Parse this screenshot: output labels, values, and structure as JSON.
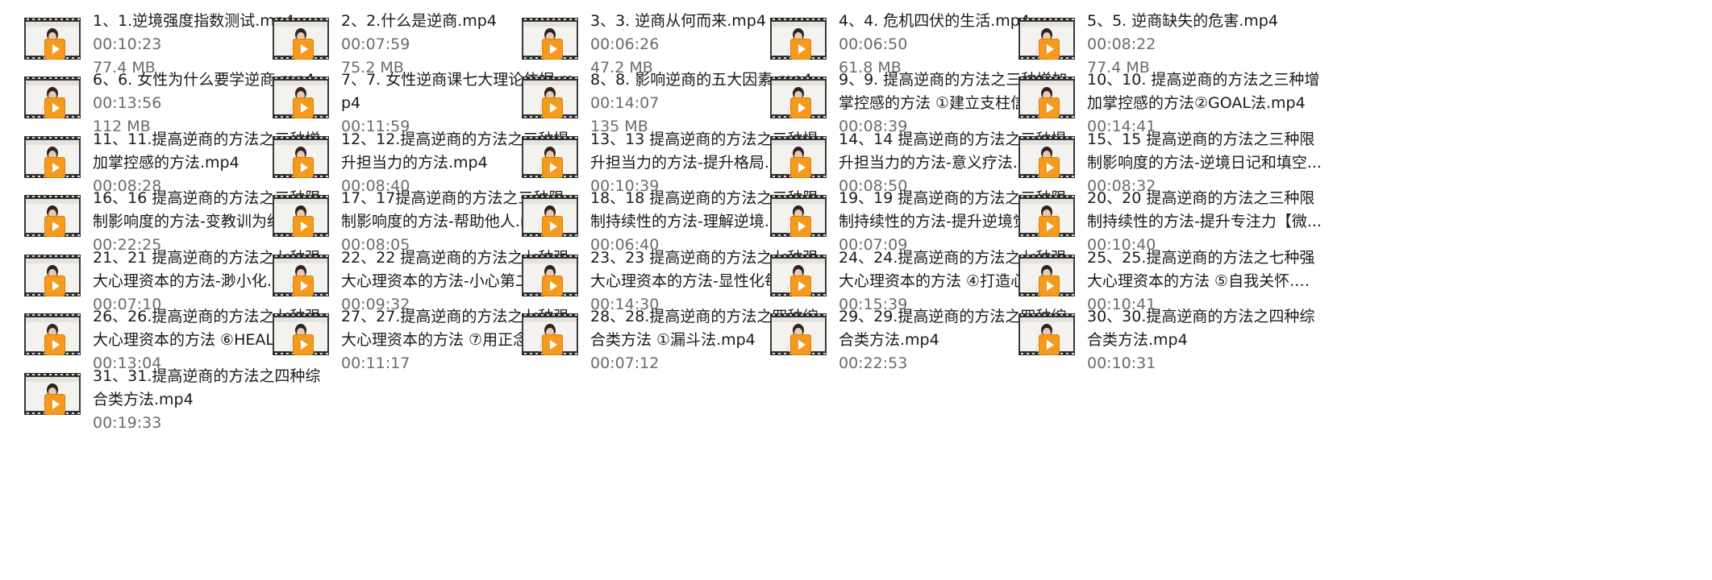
{
  "colors": {
    "background": "#ffffff",
    "filename_text": "#1a1a1a",
    "meta_text": "#6b6b6b",
    "play_badge": "#f49a1e"
  },
  "icons": {
    "thumbnail": "video-thumbnail-icon",
    "play_badge": "play-icon"
  },
  "files": [
    {
      "name": "1、1.逆境强度指数测试.mp4",
      "duration": "00:10:23",
      "size": "77.4 MB"
    },
    {
      "name": "2、2.什么是逆商.mp4",
      "duration": "00:07:59",
      "size": "75.2 MB"
    },
    {
      "name": "3、3. 逆商从何而来.mp4",
      "duration": "00:06:26",
      "size": "47.2 MB"
    },
    {
      "name": "4、4. 危机四伏的生活.mp4",
      "duration": "00:06:50",
      "size": "61.8 MB"
    },
    {
      "name": "5、5. 逆商缺失的危害.mp4",
      "duration": "00:08:22",
      "size": "77.4 MB"
    },
    {
      "name": "6、6. 女性为什么要学逆商.mp4",
      "duration": "00:13:56",
      "size": "112 MB"
    },
    {
      "name": "7、7. 女性逆商课七大理论依据.mp4",
      "duration": "00:11:59",
      "size": ""
    },
    {
      "name": "8、8. 影响逆商的五大因素.mp4",
      "duration": "00:14:07",
      "size": "135 MB"
    },
    {
      "name": "9、9. 提高逆商的方法之三种增加掌控感的方法 ①建立支柱信念.m...",
      "duration": "00:08:39",
      "size": ""
    },
    {
      "name": "10、10. 提高逆商的方法之三种增加掌控感的方法②GOAL法.mp4",
      "duration": "00:14:41",
      "size": ""
    },
    {
      "name": "11、11.提高逆商的方法之三种增加掌控感的方法.mp4",
      "duration": "00:08:28",
      "size": ""
    },
    {
      "name": "12、12.提高逆商的方法之三种提升担当力的方法.mp4",
      "duration": "00:08:40",
      "size": ""
    },
    {
      "name": "13、13 提高逆商的方法之三种提升担当力的方法-提升格局.mp4",
      "duration": "00:10:39",
      "size": ""
    },
    {
      "name": "14、14 提高逆商的方法之三种提升担当力的方法-意义疗法.mp4",
      "duration": "00:08:50",
      "size": ""
    },
    {
      "name": "15、15 提高逆商的方法之三种限制影响度的方法-逆境日记和填空...",
      "duration": "00:08:32",
      "size": ""
    },
    {
      "name": "16、16 提高逆商的方法之三种限制影响度的方法-变教训为经验.m...",
      "duration": "00:22:25",
      "size": ""
    },
    {
      "name": "17、17提高逆商的方法之三种限制影响度的方法-帮助他人.mp4",
      "duration": "00:08:05",
      "size": ""
    },
    {
      "name": "18、18 提高逆商的方法之三种限制持续性的方法-理解逆境.mp4",
      "duration": "00:06:40",
      "size": ""
    },
    {
      "name": "19、19 提高逆商的方法之三种限制持续性的方法-提升逆境觉知力...",
      "duration": "00:07:09",
      "size": ""
    },
    {
      "name": "20、20 提高逆商的方法之三种限制持续性的方法-提升专注力【微...",
      "duration": "00:10:40",
      "size": ""
    },
    {
      "name": "21、21 提高逆商的方法之七种强大心理资本的方法-渺小化.mp4",
      "duration": "00:07:10",
      "size": ""
    },
    {
      "name": "22、22 提高逆商的方法之七种强大心理资本的方法-小心第二镖.m...",
      "duration": "00:09:32",
      "size": ""
    },
    {
      "name": "23、23 提高逆商的方法之七种强大心理资本的方法-显性化每日珍...",
      "duration": "00:14:30",
      "size": ""
    },
    {
      "name": "24、24.提高逆商的方法之七种强大心理资本的方法 ④打造心灵花.m...",
      "duration": "00:15:39",
      "size": ""
    },
    {
      "name": "25、25.提高逆商的方法之七种强大心理资本的方法 ⑤自我关怀.mp4",
      "duration": "00:10:41",
      "size": ""
    },
    {
      "name": "26、26.提高逆商的方法之七种强大心理资本的方法 ⑥HEAL疗法.mp4",
      "duration": "00:13:04",
      "size": ""
    },
    {
      "name": "27、27.提高逆商的方法之七种强大心理资本的方法 ⑦用正念干预意...",
      "duration": "00:11:17",
      "size": ""
    },
    {
      "name": "28、28.提高逆商的方法之四种综合类方法 ①漏斗法.mp4",
      "duration": "00:07:12",
      "size": ""
    },
    {
      "name": "29、29.提高逆商的方法之四种综合类方法.mp4",
      "duration": "00:22:53",
      "size": ""
    },
    {
      "name": "30、30.提高逆商的方法之四种综合类方法.mp4",
      "duration": "00:10:31",
      "size": ""
    },
    {
      "name": "31、31.提高逆商的方法之四种综合类方法.mp4",
      "duration": "00:19:33",
      "size": ""
    }
  ]
}
